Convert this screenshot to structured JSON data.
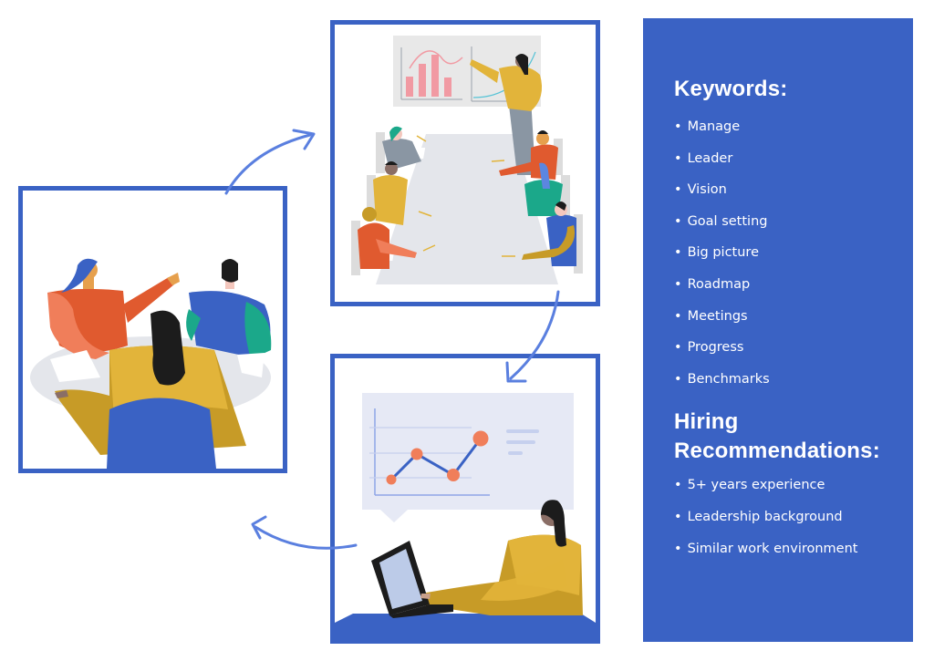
{
  "panel": {
    "keywords_heading": "Keywords:",
    "keywords": [
      "Manage",
      "Leader",
      "Vision",
      "Goal setting",
      "Big picture",
      "Roadmap",
      "Meetings",
      "Progress",
      "Benchmarks"
    ],
    "hiring_heading_line1": "Hiring",
    "hiring_heading_line2": "Recommendations:",
    "hiring": [
      "5+ years experience",
      "Leadership background",
      "Similar work environment"
    ],
    "bullet": "•"
  },
  "illustrations": {
    "left": "team-discussion-round-table",
    "top": "presentation-meeting-boardroom",
    "bottom": "person-at-laptop-reviewing-line-chart"
  },
  "colors": {
    "brand_blue": "#3a62c4",
    "yellow": "#e2b43a",
    "orange": "#e05a2f",
    "coral": "#f07e5a",
    "teal": "#1ba88a",
    "grey": "#8a96a3",
    "pink": "#f19aa3",
    "table_grey": "#e4e6eb"
  }
}
